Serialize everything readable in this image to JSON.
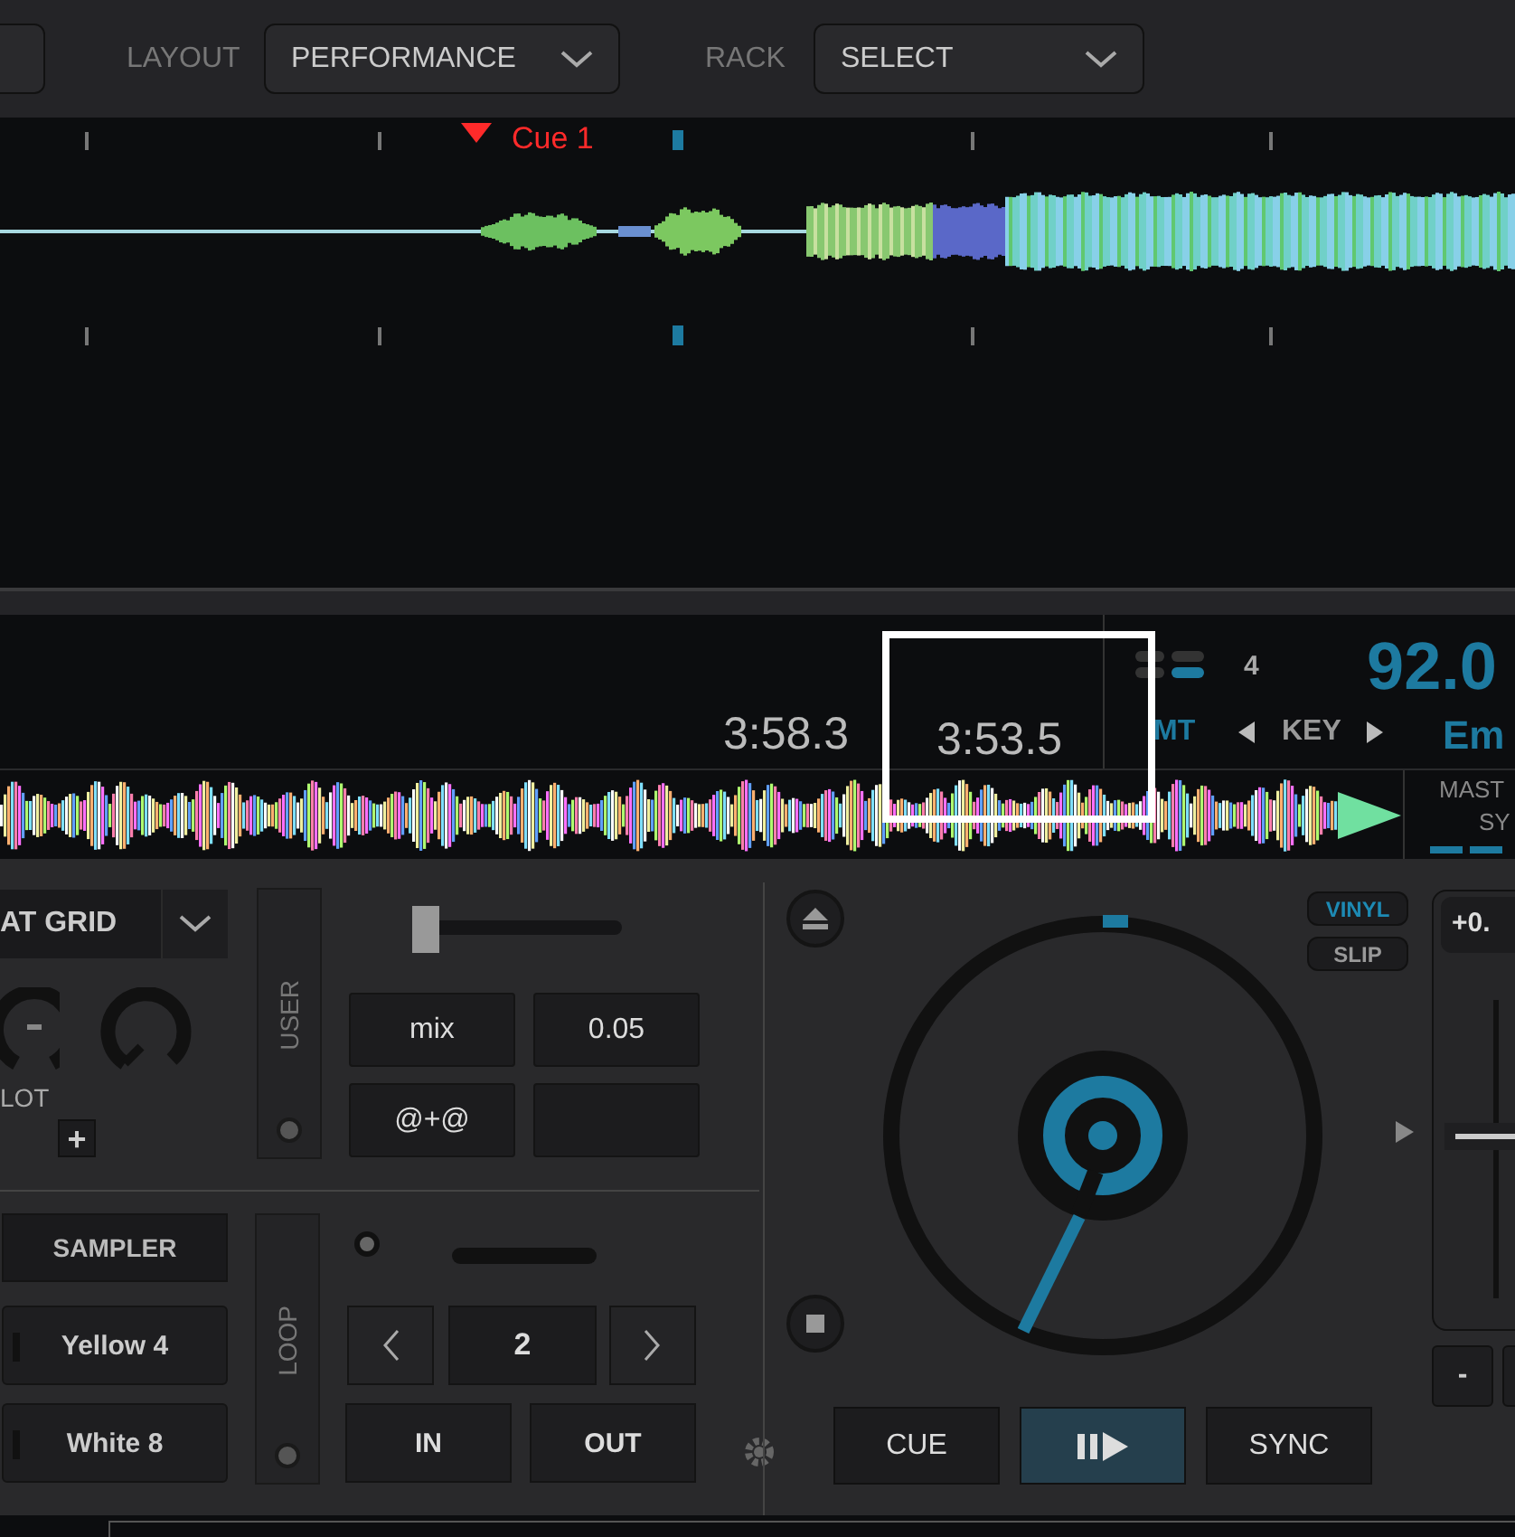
{
  "top_bar": {
    "layout_label": "LAYOUT",
    "layout_value": "PERFORMANCE",
    "rack_label": "RACK",
    "rack_value": "SELECT"
  },
  "waveform": {
    "cue": "Cue 1"
  },
  "info": {
    "elapsed": "3:58.3",
    "remaining": "3:53.5",
    "beat_count": "4",
    "bpm": "92.0",
    "key_mode": "MT",
    "key_label": "KEY",
    "key": "Em"
  },
  "overview": {
    "master_label": "MAST",
    "sync_label": "SY"
  },
  "effects": {
    "selector": "AT GRID",
    "knob_label": "LOT",
    "add": "+",
    "user_tab": "USER",
    "slider": {
      "level": 0.0
    }
  },
  "pads": [
    {
      "kind": "text",
      "label": "mix"
    },
    {
      "kind": "text",
      "label": "0.05"
    },
    {
      "kind": "text",
      "label": "@+@"
    },
    {
      "kind": "blank"
    }
  ],
  "sampler": {
    "button": "SAMPLER",
    "slots": [
      {
        "label": "Yellow 4"
      },
      {
        "label": "White 8"
      }
    ]
  },
  "loop": {
    "tab": "LOOP",
    "size": "2",
    "in": "IN",
    "out": "OUT"
  },
  "deck": {
    "vinyl": {
      "label": "VINYL",
      "on": true
    },
    "slip": {
      "label": "SLIP",
      "on": false
    },
    "pitch": "+0.",
    "pitch_slider": {
      "level": 0.54
    },
    "minus": "-",
    "cue": "CUE",
    "play": {
      "active": true
    },
    "sync": "SYNC"
  }
}
